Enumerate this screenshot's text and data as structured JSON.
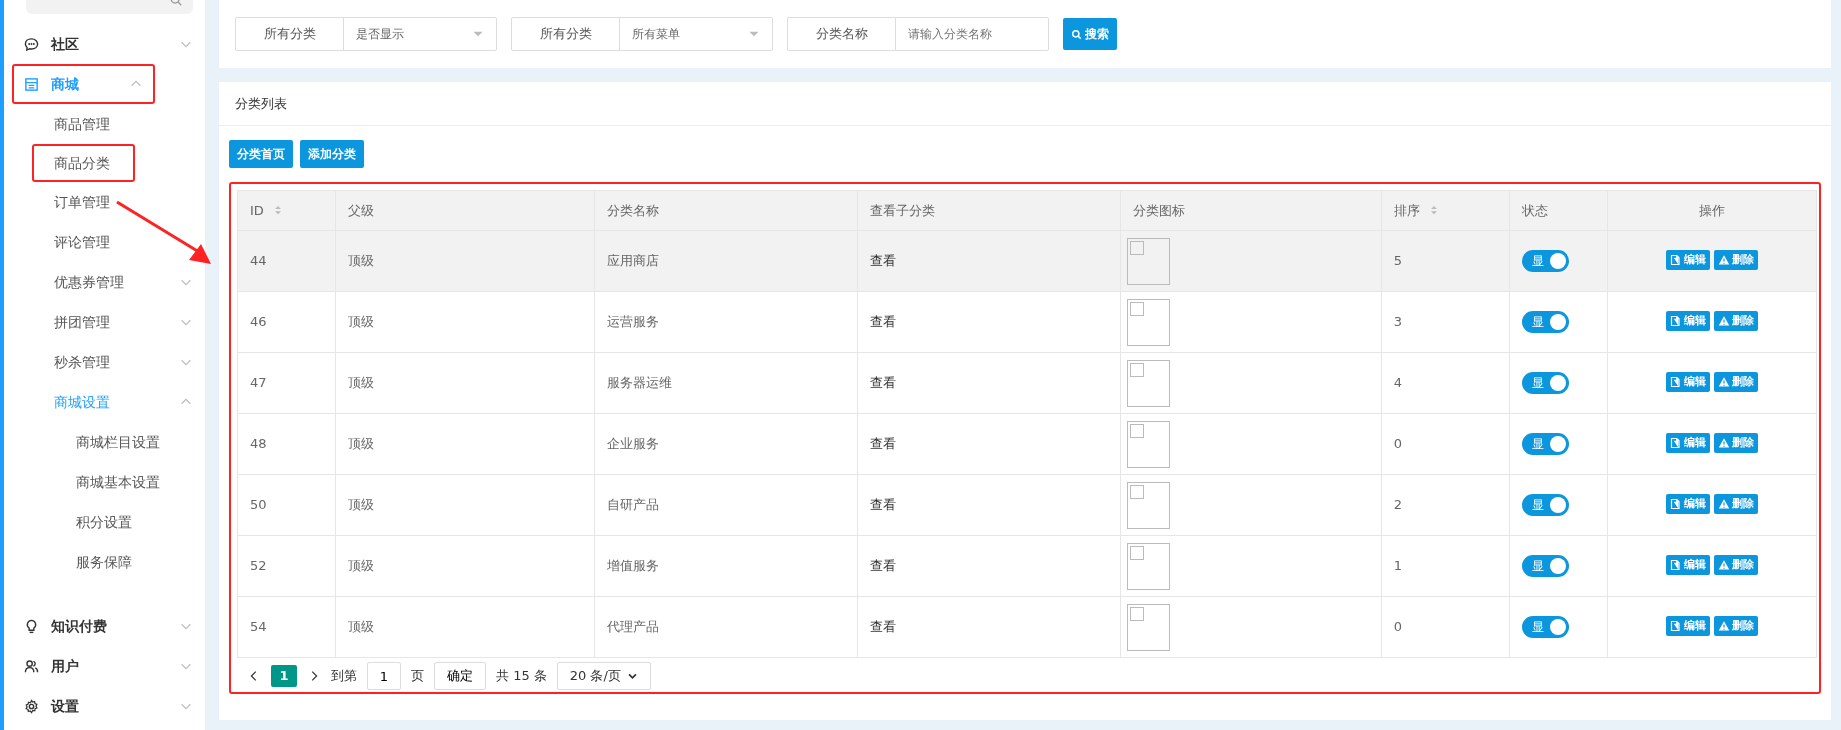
{
  "sidebar": {
    "items": [
      {
        "label": "社区",
        "selected": false,
        "expanded": false,
        "highlighted": false
      },
      {
        "label": "商城",
        "selected": true,
        "expanded": true,
        "highlighted": true,
        "children": [
          {
            "label": "商品管理",
            "selected": false,
            "highlighted": false
          },
          {
            "label": "商品分类",
            "selected": false,
            "highlighted": true
          },
          {
            "label": "订单管理",
            "selected": false,
            "highlighted": false
          },
          {
            "label": "评论管理",
            "selected": false,
            "highlighted": false
          },
          {
            "label": "优惠券管理",
            "selected": false,
            "highlighted": false,
            "expanded": false
          },
          {
            "label": "拼团管理",
            "selected": false,
            "highlighted": false,
            "expanded": false
          },
          {
            "label": "秒杀管理",
            "selected": false,
            "highlighted": false,
            "expanded": false
          },
          {
            "label": "商城设置",
            "selected": true,
            "highlighted": false,
            "expanded": true,
            "children": [
              {
                "label": "商城栏目设置"
              },
              {
                "label": "商城基本设置"
              },
              {
                "label": "积分设置"
              },
              {
                "label": "服务保障"
              }
            ]
          }
        ]
      },
      {
        "label": "知识付费",
        "selected": false,
        "expanded": false,
        "highlighted": false
      },
      {
        "label": "用户",
        "selected": false,
        "expanded": false,
        "highlighted": false
      },
      {
        "label": "设置",
        "selected": false,
        "expanded": false,
        "highlighted": false
      }
    ]
  },
  "filters": [
    {
      "kind": "select",
      "label": "所有分类",
      "value": "是否显示"
    },
    {
      "kind": "select",
      "label": "所有分类",
      "value": "所有菜单"
    },
    {
      "kind": "input",
      "label": "分类名称",
      "placeholder": "请输入分类名称"
    }
  ],
  "search_button": "搜索",
  "panel": {
    "title": "分类列表",
    "buttons": [
      "分类首页",
      "添加分类"
    ]
  },
  "table": {
    "highlighted": true,
    "columns": [
      {
        "label": "ID",
        "sortable": true
      },
      {
        "label": "父级",
        "sortable": false
      },
      {
        "label": "分类名称",
        "sortable": false
      },
      {
        "label": "查看子分类",
        "sortable": false
      },
      {
        "label": "分类图标",
        "sortable": false
      },
      {
        "label": "排序",
        "sortable": true
      },
      {
        "label": "状态",
        "sortable": false
      },
      {
        "label": "操作",
        "sortable": false
      }
    ],
    "rows": [
      {
        "id": "44",
        "parent": "顶级",
        "name": "应用商店",
        "view": "查看",
        "sort": "5",
        "status": "显",
        "on": true,
        "hovered": true,
        "actions": [
          "编辑",
          "删除"
        ]
      },
      {
        "id": "46",
        "parent": "顶级",
        "name": "运营服务",
        "view": "查看",
        "sort": "3",
        "status": "显",
        "on": true,
        "hovered": false,
        "actions": [
          "编辑",
          "删除"
        ]
      },
      {
        "id": "47",
        "parent": "顶级",
        "name": "服务器运维",
        "view": "查看",
        "sort": "4",
        "status": "显",
        "on": true,
        "hovered": false,
        "actions": [
          "编辑",
          "删除"
        ]
      },
      {
        "id": "48",
        "parent": "顶级",
        "name": "企业服务",
        "view": "查看",
        "sort": "0",
        "status": "显",
        "on": true,
        "hovered": false,
        "actions": [
          "编辑",
          "删除"
        ]
      },
      {
        "id": "50",
        "parent": "顶级",
        "name": "自研产品",
        "view": "查看",
        "sort": "2",
        "status": "显",
        "on": true,
        "hovered": false,
        "actions": [
          "编辑",
          "删除"
        ]
      },
      {
        "id": "52",
        "parent": "顶级",
        "name": "增值服务",
        "view": "查看",
        "sort": "1",
        "status": "显",
        "on": true,
        "hovered": false,
        "actions": [
          "编辑",
          "删除"
        ]
      },
      {
        "id": "54",
        "parent": "顶级",
        "name": "代理产品",
        "view": "查看",
        "sort": "0",
        "status": "显",
        "on": true,
        "hovered": false,
        "actions": [
          "编辑",
          "删除"
        ]
      }
    ]
  },
  "pagination": {
    "pages": [
      {
        "label": "1",
        "selected": true
      }
    ],
    "goto_label": "到第",
    "goto_value": "1",
    "page_unit": "页",
    "confirm": "确定",
    "total": "共 15 条",
    "page_size": "20 条/页"
  },
  "annotation_arrow": true
}
